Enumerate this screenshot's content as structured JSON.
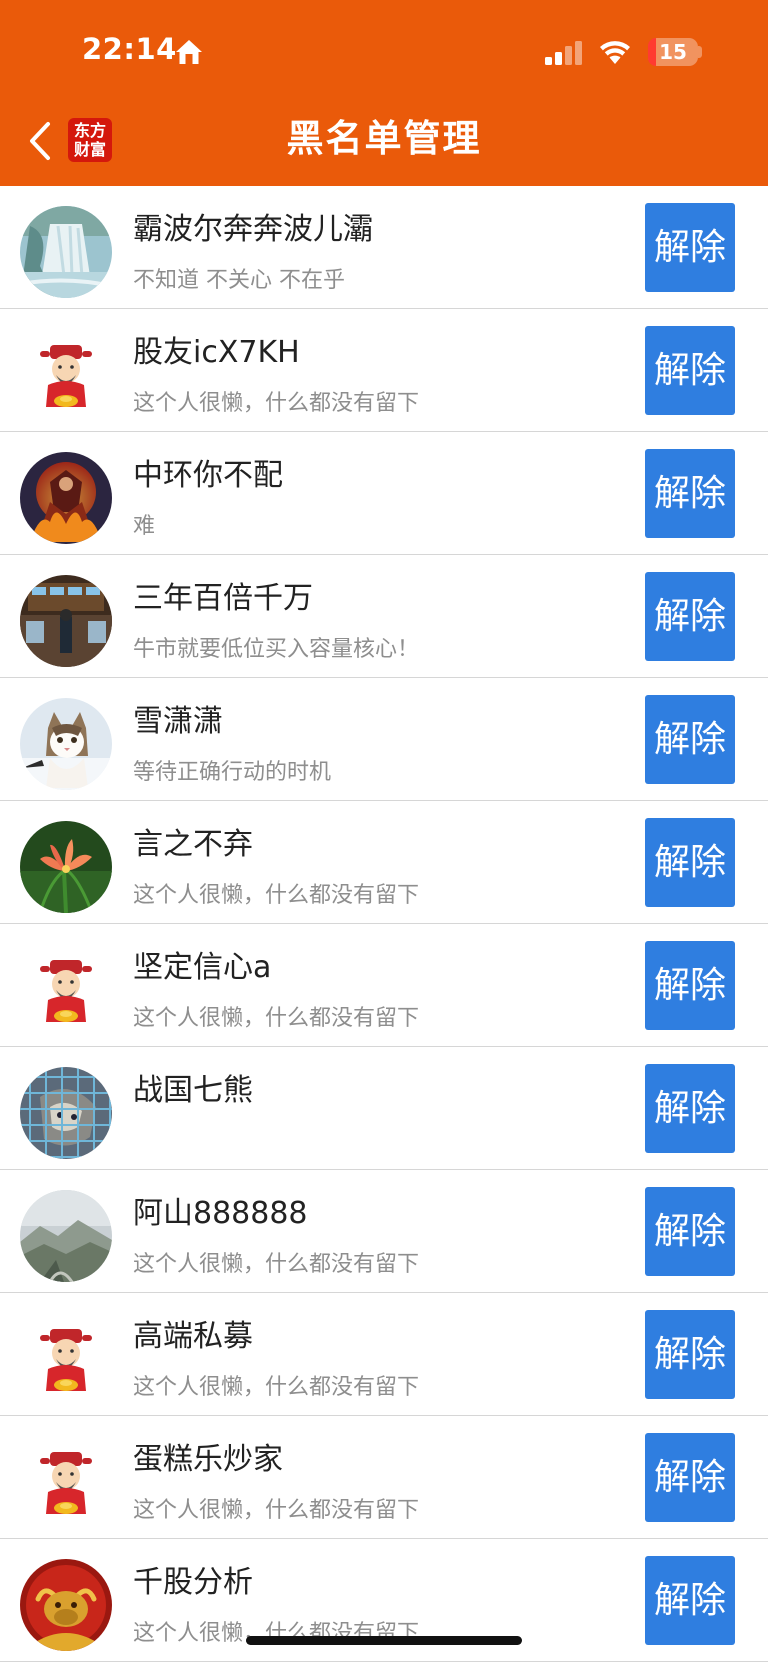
{
  "status_bar": {
    "time": "22:14",
    "battery_level": "15"
  },
  "header": {
    "title": "黑名单管理",
    "logo_line1": "东方",
    "logo_line2": "财富",
    "background_color": "#ea5a0a"
  },
  "unblock_color": "#2f7ee0",
  "rows": [
    {
      "name": "霸波尔奔奔波儿灞",
      "bio": "不知道 不关心 不在乎",
      "button": "解除",
      "avatar": "waterfall"
    },
    {
      "name": "股友icX7KH",
      "bio": "这个人很懒，什么都没有留下",
      "button": "解除",
      "avatar": "fortune-god"
    },
    {
      "name": "中环你不配",
      "bio": "难",
      "button": "解除",
      "avatar": "warrior"
    },
    {
      "name": "三年百倍千万",
      "bio": "牛市就要低位买入容量核心！",
      "button": "解除",
      "avatar": "trading-floor"
    },
    {
      "name": "雪潇潇",
      "bio": "等待正确行动的时机",
      "button": "解除",
      "avatar": "cat-snow"
    },
    {
      "name": "言之不弃",
      "bio": "这个人很懒，什么都没有留下",
      "button": "解除",
      "avatar": "flower"
    },
    {
      "name": "坚定信心a",
      "bio": "这个人很懒，什么都没有留下",
      "button": "解除",
      "avatar": "fortune-god"
    },
    {
      "name": "战国七熊",
      "bio": "",
      "button": "解除",
      "avatar": "cat-cage"
    },
    {
      "name": "阿山888888",
      "bio": "这个人很懒，什么都没有留下",
      "button": "解除",
      "avatar": "mountain"
    },
    {
      "name": "高端私募",
      "bio": "这个人很懒，什么都没有留下",
      "button": "解除",
      "avatar": "fortune-god"
    },
    {
      "name": "蛋糕乐炒家",
      "bio": "这个人很懒，什么都没有留下",
      "button": "解除",
      "avatar": "fortune-god"
    },
    {
      "name": "千股分析",
      "bio": "这个人很懒，什么都没有留下",
      "button": "解除",
      "avatar": "golden-bull"
    }
  ]
}
